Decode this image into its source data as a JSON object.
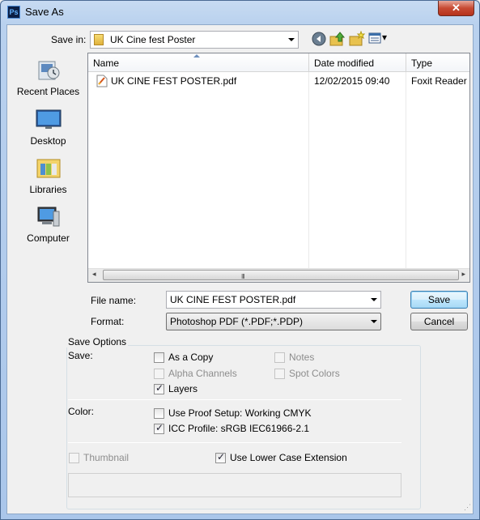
{
  "window": {
    "title": "Save As",
    "app_icon_text": "Ps",
    "close_glyph": "✕"
  },
  "save_in": {
    "label": "Save in:",
    "value": "UK Cine fest Poster"
  },
  "toolbar": {
    "back_glyph": "◀",
    "views_glyph": "▾"
  },
  "places": [
    {
      "label": "Recent Places",
      "icon": "recent-places-icon"
    },
    {
      "label": "Desktop",
      "icon": "desktop-icon"
    },
    {
      "label": "Libraries",
      "icon": "libraries-icon"
    },
    {
      "label": "Computer",
      "icon": "computer-icon"
    }
  ],
  "file_list": {
    "columns": [
      "Name",
      "Date modified",
      "Type"
    ],
    "rows": [
      {
        "name": "UK CINE FEST POSTER.pdf",
        "date": "12/02/2015 09:40",
        "type": "Foxit Reader P"
      }
    ],
    "scroll_left": "◂",
    "scroll_right": "▸",
    "grip": "III"
  },
  "file_name": {
    "label": "File name:",
    "value": "UK CINE FEST POSTER.pdf"
  },
  "format": {
    "label": "Format:",
    "value": "Photoshop PDF (*.PDF;*.PDP)"
  },
  "buttons": {
    "save": "Save",
    "cancel": "Cancel"
  },
  "save_options": {
    "title": "Save Options",
    "save_label": "Save:",
    "as_a_copy": {
      "label": "As a Copy",
      "checked": false,
      "enabled": true
    },
    "notes": {
      "label": "Notes",
      "checked": false,
      "enabled": false
    },
    "alpha_channels": {
      "label": "Alpha Channels",
      "checked": false,
      "enabled": false
    },
    "spot_colors": {
      "label": "Spot Colors",
      "checked": false,
      "enabled": false
    },
    "layers": {
      "label": "Layers",
      "checked": true,
      "enabled": true
    },
    "color_label": "Color:",
    "use_proof_setup": {
      "label": "Use Proof Setup:  Working CMYK",
      "checked": false,
      "enabled": true
    },
    "icc_profile": {
      "label": "ICC Profile:  sRGB IEC61966-2.1",
      "checked": true,
      "enabled": true
    },
    "thumbnail": {
      "label": "Thumbnail",
      "checked": false,
      "enabled": false
    },
    "lower_case_extension": {
      "label": "Use Lower Case Extension",
      "checked": true,
      "enabled": true
    }
  },
  "tick_glyph": "✓",
  "resize_grip": "⋰"
}
